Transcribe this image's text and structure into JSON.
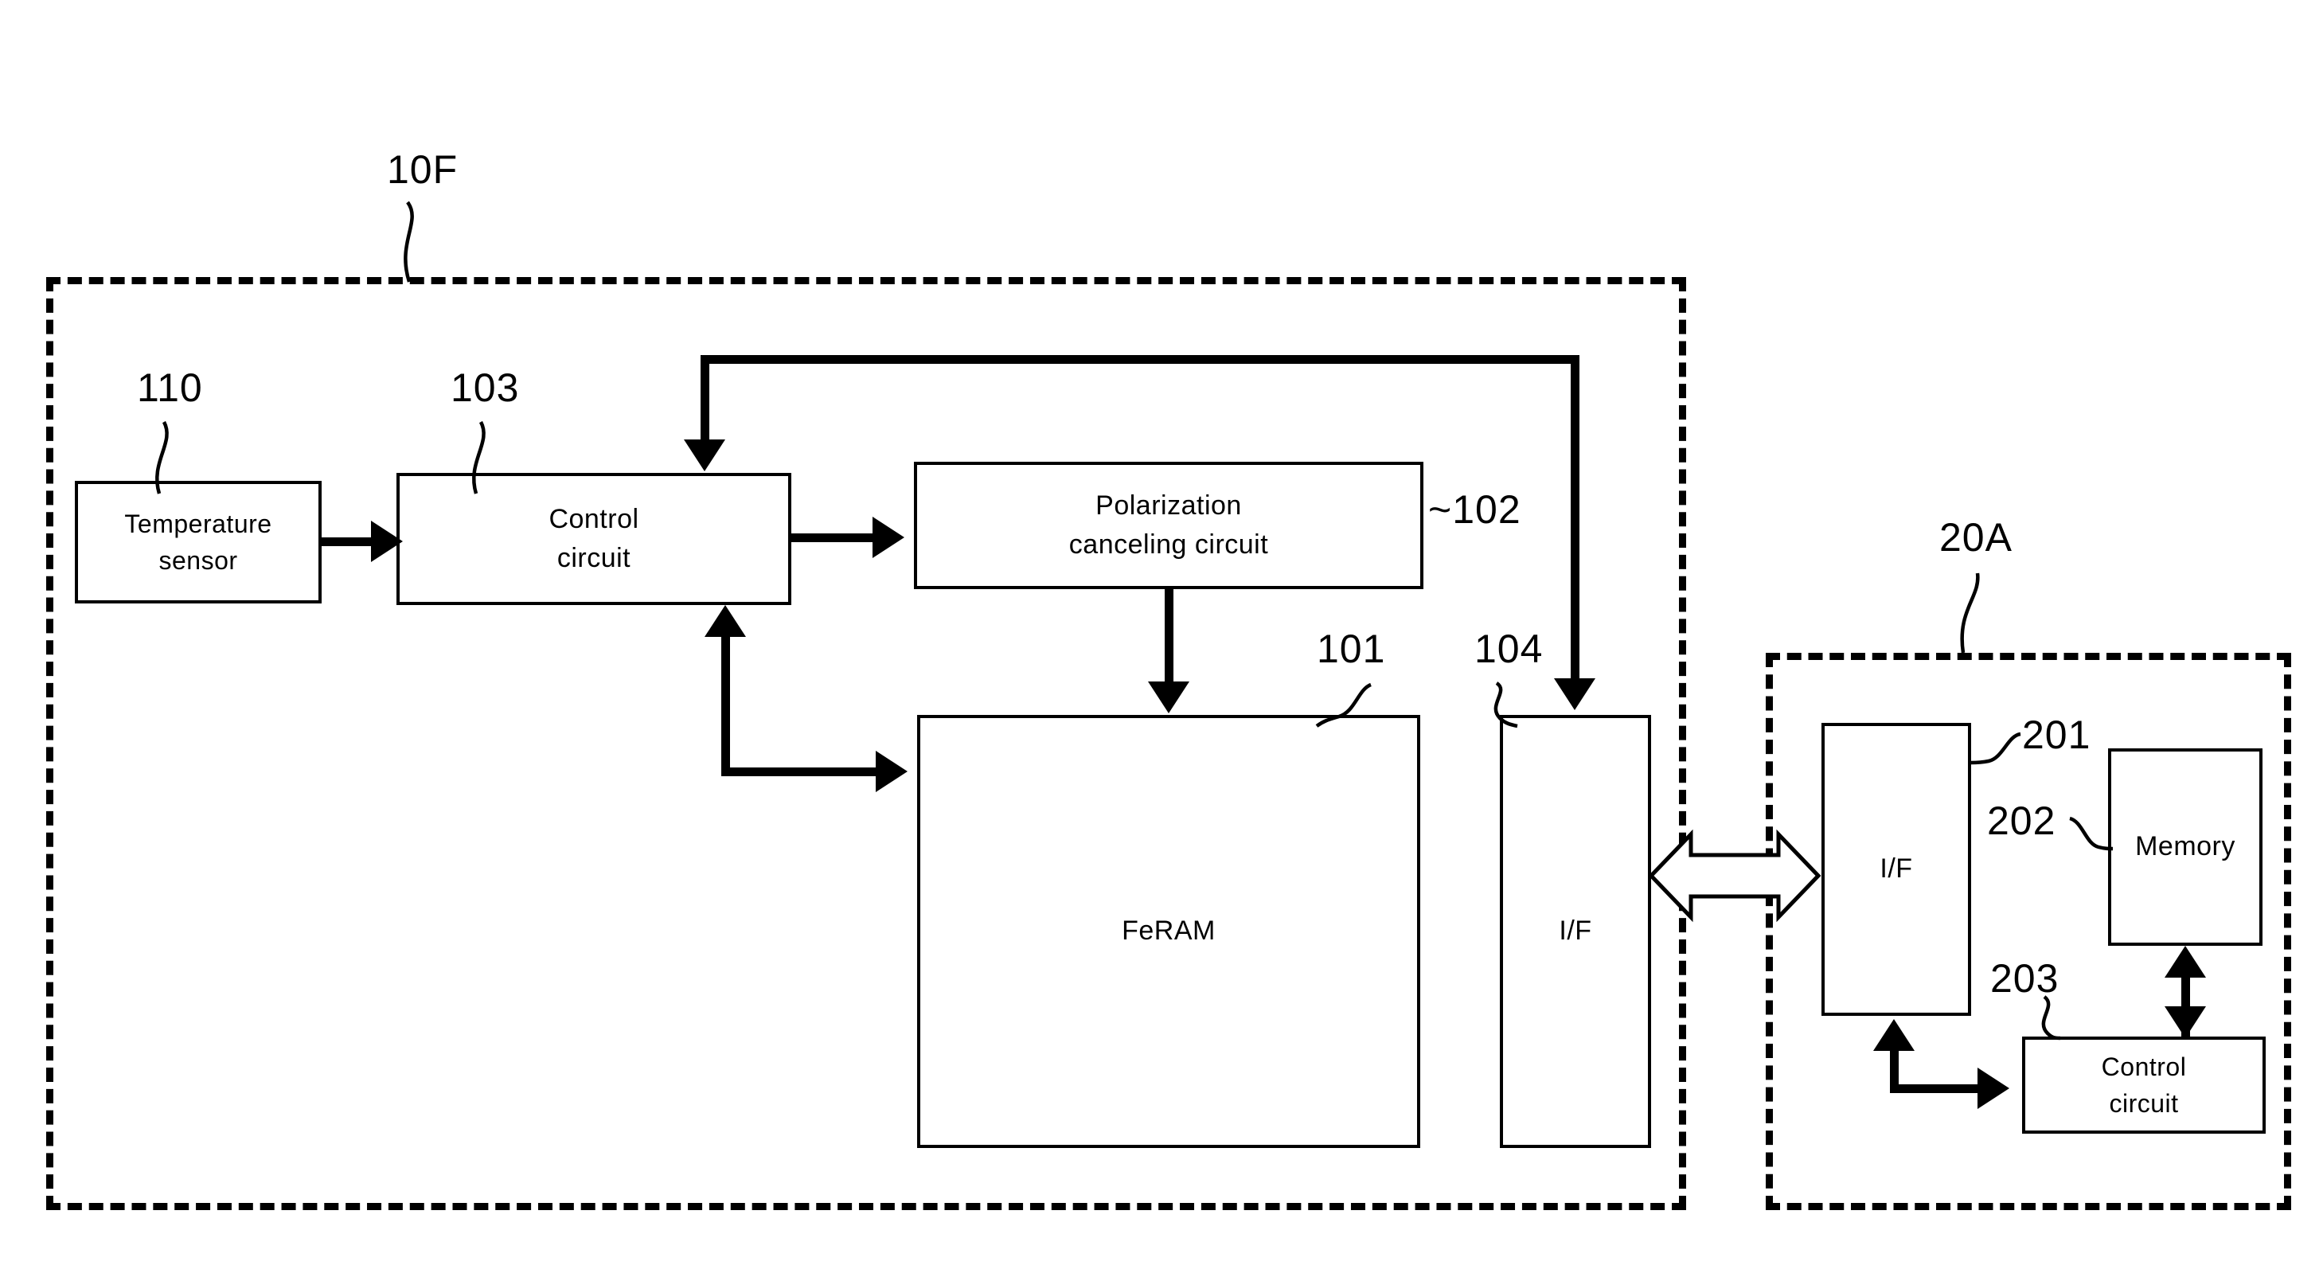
{
  "figure": {
    "type": "block-diagram",
    "background": "#ffffff",
    "stroke_color": "#000000"
  },
  "enclosures": [
    {
      "id": "10F",
      "label": "10F",
      "style": "dashed"
    },
    {
      "id": "20A",
      "label": "20A",
      "style": "dashed"
    }
  ],
  "blocks": {
    "temperature_sensor": {
      "label_line1": "Temperature",
      "label_line2": "sensor",
      "ref": "110"
    },
    "control_circuit_left": {
      "label_line1": "Control",
      "label_line2": "circuit",
      "ref": "103"
    },
    "polarization_canceling_circuit": {
      "label_line1": "Polarization",
      "label_line2": "canceling circuit",
      "ref": "102"
    },
    "feram": {
      "label": "FeRAM",
      "ref": "101"
    },
    "interface_device": {
      "label": "I/F",
      "ref": "104"
    },
    "interface_host": {
      "label": "I/F",
      "ref": "201"
    },
    "memory": {
      "label": "Memory",
      "ref": "202"
    },
    "control_circuit_right": {
      "label_line1": "Control",
      "label_line2": "circuit",
      "ref": "203"
    }
  },
  "reference_numerals": {
    "n10F": "10F",
    "n110": "110",
    "n103": "103",
    "n102": "~102",
    "n101": "101",
    "n104": "104",
    "n20A": "20A",
    "n201": "201",
    "n202": "202",
    "n203": "203"
  },
  "connections": [
    {
      "from": "temperature_sensor",
      "to": "control_circuit_left",
      "arrow": "single"
    },
    {
      "from": "control_circuit_left",
      "to": "polarization_canceling_circuit",
      "arrow": "single"
    },
    {
      "from": "polarization_canceling_circuit",
      "to": "feram",
      "arrow": "single"
    },
    {
      "from": "control_circuit_left",
      "to": "feram",
      "arrow": "double"
    },
    {
      "from": "control_circuit_left",
      "to": "interface_device",
      "arrow": "double"
    },
    {
      "from": "interface_device",
      "to": "interface_host",
      "arrow": "bus-double"
    },
    {
      "from": "interface_host",
      "to": "control_circuit_right",
      "arrow": "double"
    },
    {
      "from": "control_circuit_right",
      "to": "memory",
      "arrow": "double"
    }
  ]
}
